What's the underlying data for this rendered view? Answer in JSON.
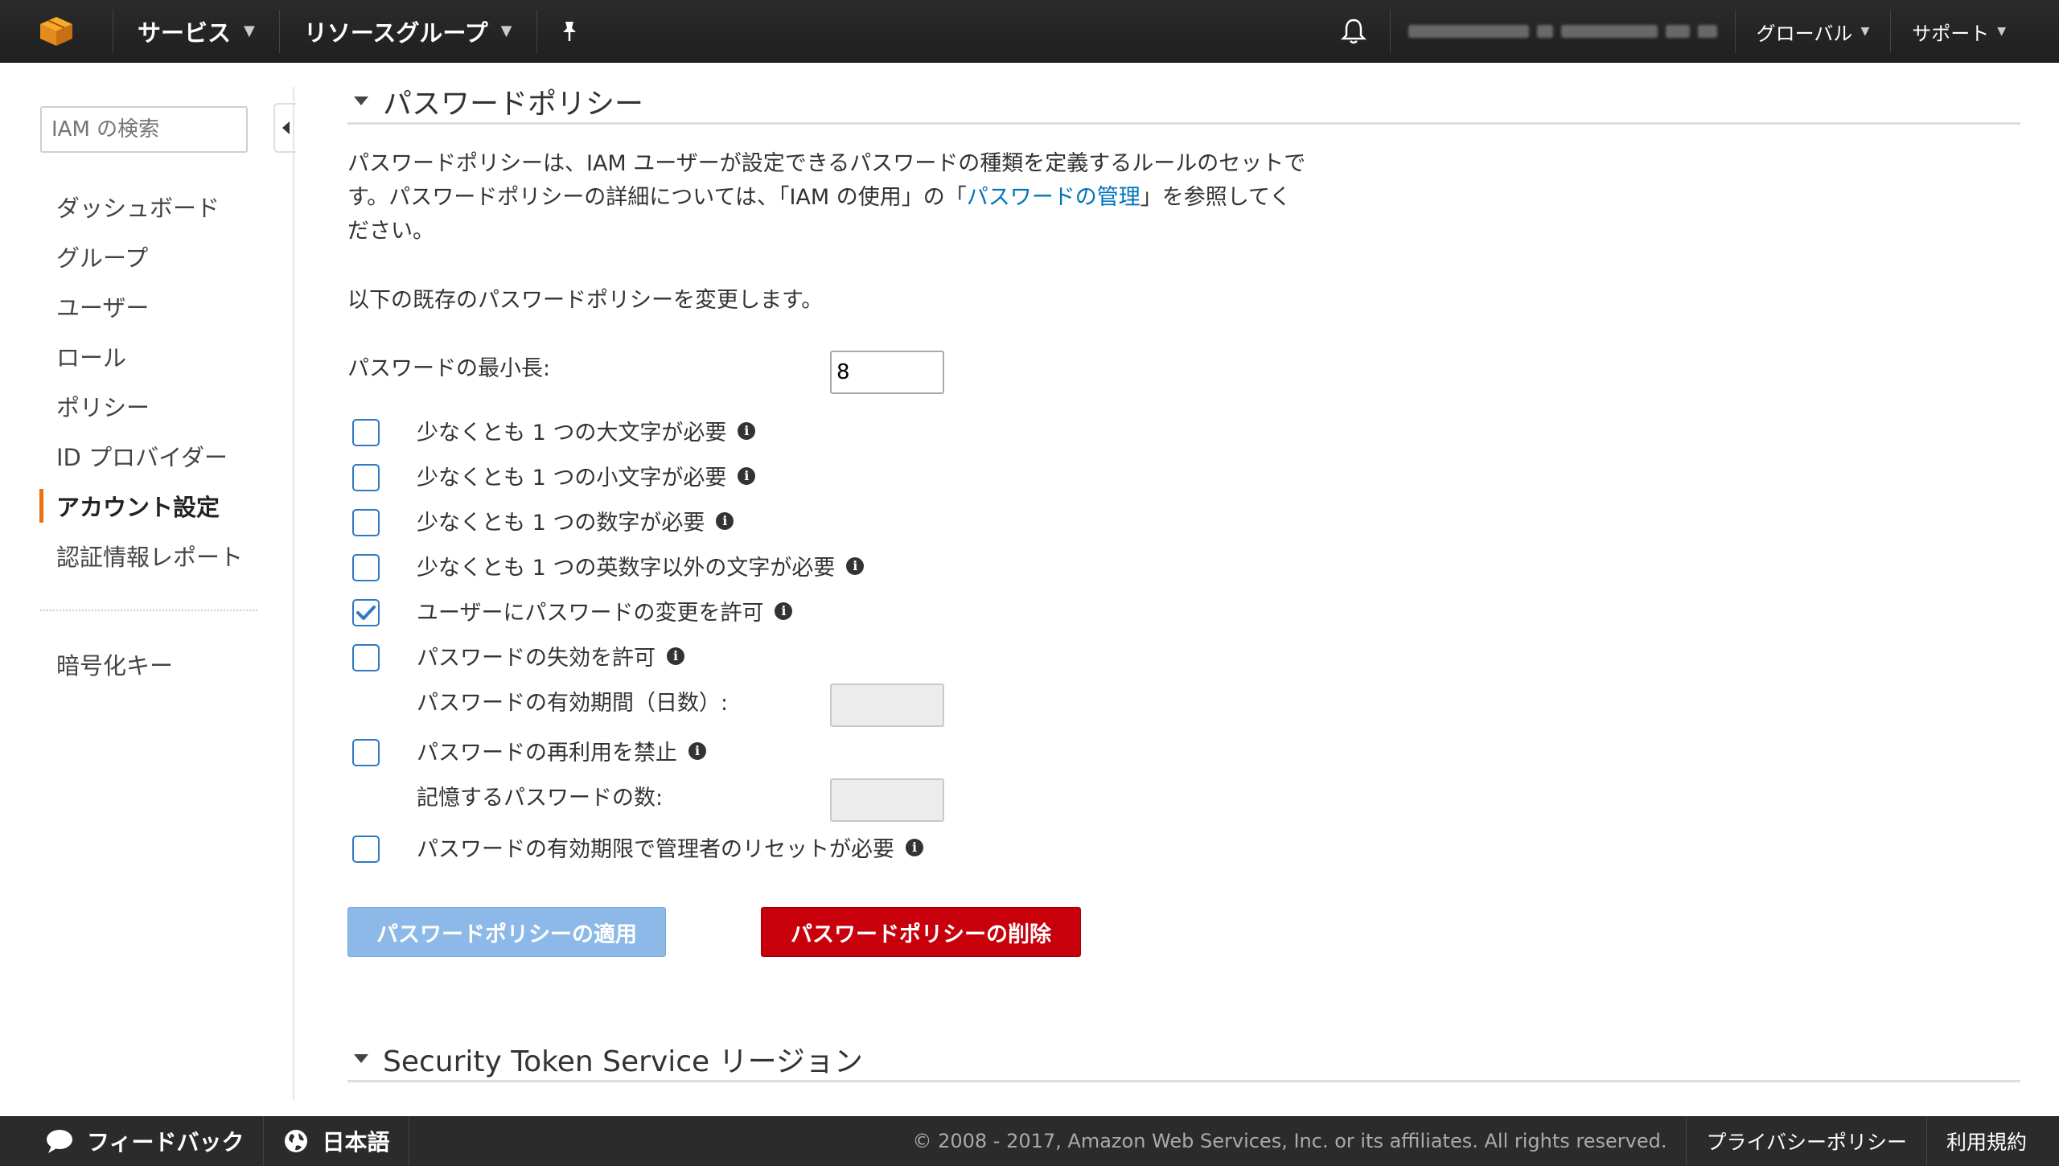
{
  "topbar": {
    "services": "サービス",
    "resource_groups": "リソースグループ",
    "region": "グローバル",
    "support": "サポート"
  },
  "sidebar": {
    "search_placeholder": "IAM の検索",
    "items": [
      {
        "label": "ダッシュボード"
      },
      {
        "label": "グループ"
      },
      {
        "label": "ユーザー"
      },
      {
        "label": "ロール"
      },
      {
        "label": "ポリシー"
      },
      {
        "label": "ID プロバイダー"
      },
      {
        "label": "アカウント設定",
        "active": true
      },
      {
        "label": "認証情報レポート"
      }
    ],
    "extra": "暗号化キー"
  },
  "main": {
    "section_title": "パスワードポリシー",
    "desc_before": "パスワードポリシーは、IAM ユーザーが設定できるパスワードの種類を定義するルールのセットです。パスワードポリシーの詳細については、「IAM の使用」の「",
    "desc_link": "パスワードの管理",
    "desc_after": "」を参照してください。",
    "intro": "以下の既存のパスワードポリシーを変更します。",
    "min_length_label": "パスワードの最小長:",
    "min_length_value": "8",
    "options": [
      {
        "label": "少なくとも 1 つの大文字が必要",
        "checked": false
      },
      {
        "label": "少なくとも 1 つの小文字が必要",
        "checked": false
      },
      {
        "label": "少なくとも 1 つの数字が必要",
        "checked": false
      },
      {
        "label": "少なくとも 1 つの英数字以外の文字が必要",
        "checked": false
      },
      {
        "label": "ユーザーにパスワードの変更を許可",
        "checked": true
      },
      {
        "label": "パスワードの失効を許可",
        "checked": false
      }
    ],
    "expiry_label": "パスワードの有効期間（日数）:",
    "reuse_label": "パスワードの再利用を禁止",
    "remember_label": "記憶するパスワードの数:",
    "admin_reset_label": "パスワードの有効期限で管理者のリセットが必要",
    "apply_button": "パスワードポリシーの適用",
    "delete_button": "パスワードポリシーの削除",
    "sts_title": "Security Token Service リージョン"
  },
  "footer": {
    "feedback": "フィードバック",
    "language": "日本語",
    "copyright": "© 2008 - 2017, Amazon Web Services, Inc. or its affiliates. All rights reserved.",
    "privacy": "プライバシーポリシー",
    "terms": "利用規約"
  },
  "colors": {
    "accent": "#ec7211",
    "link": "#0073bb",
    "checkbox": "#2f78c4",
    "apply_button": "#8db9e8",
    "delete_button": "#c7000b"
  }
}
